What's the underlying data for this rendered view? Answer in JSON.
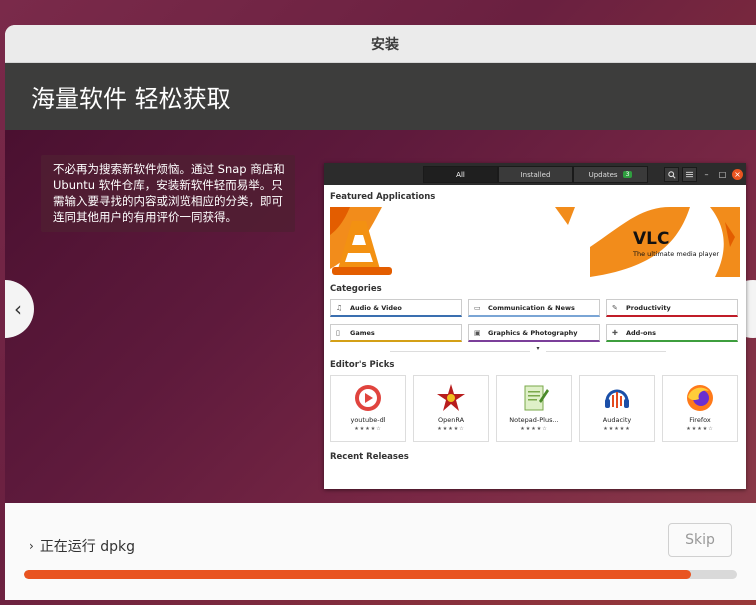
{
  "window": {
    "title": "安装"
  },
  "banner": {
    "title": "海量软件 轻松获取"
  },
  "slide": {
    "description": "不必再为搜索新软件烦恼。通过 Snap 商店和 Ubuntu 软件仓库，安装新软件轻而易举。只需输入要寻找的内容或浏览相应的分类，即可连同其他用户的有用评价一同获得。",
    "prev_icon": "‹",
    "next_icon": "›"
  },
  "software_app": {
    "tabs": [
      {
        "label": "All",
        "active": true
      },
      {
        "label": "Installed"
      },
      {
        "label": "Updates",
        "badge": "3"
      }
    ],
    "featured_title": "Featured Applications",
    "featured": {
      "name": "VLC",
      "subtitle": "The ultimate media player"
    },
    "categories_title": "Categories",
    "categories": [
      {
        "label": "Audio & Video",
        "icon": "music-note-icon",
        "color": "#3a6fb0"
      },
      {
        "label": "Communication & News",
        "icon": "message-icon",
        "color": "#7aa5d5"
      },
      {
        "label": "Productivity",
        "icon": "document-icon",
        "color": "#c01c28"
      },
      {
        "label": "Games",
        "icon": "games-icon",
        "color": "#d4a017"
      },
      {
        "label": "Graphics & Photography",
        "icon": "image-icon",
        "color": "#7b3f9a"
      },
      {
        "label": "Add-ons",
        "icon": "puzzle-icon",
        "color": "#3d9e3d"
      }
    ],
    "more_icon": "▾",
    "editors_picks_title": "Editor's Picks",
    "picks": [
      {
        "name": "youtube-dl",
        "stars": "★★★★☆"
      },
      {
        "name": "OpenRA",
        "stars": "★★★★☆"
      },
      {
        "name": "Notepad-Plus...",
        "stars": "★★★★☆"
      },
      {
        "name": "Audacity",
        "stars": "★★★★★"
      },
      {
        "name": "Firefox",
        "stars": "★★★★☆"
      }
    ],
    "recent_releases_title": "Recent Releases"
  },
  "footer": {
    "status_arrow": "›",
    "status_text": "正在运行 dpkg",
    "skip_label": "Skip",
    "progress_percent": 93.5
  },
  "colors": {
    "accent": "#e95420"
  }
}
